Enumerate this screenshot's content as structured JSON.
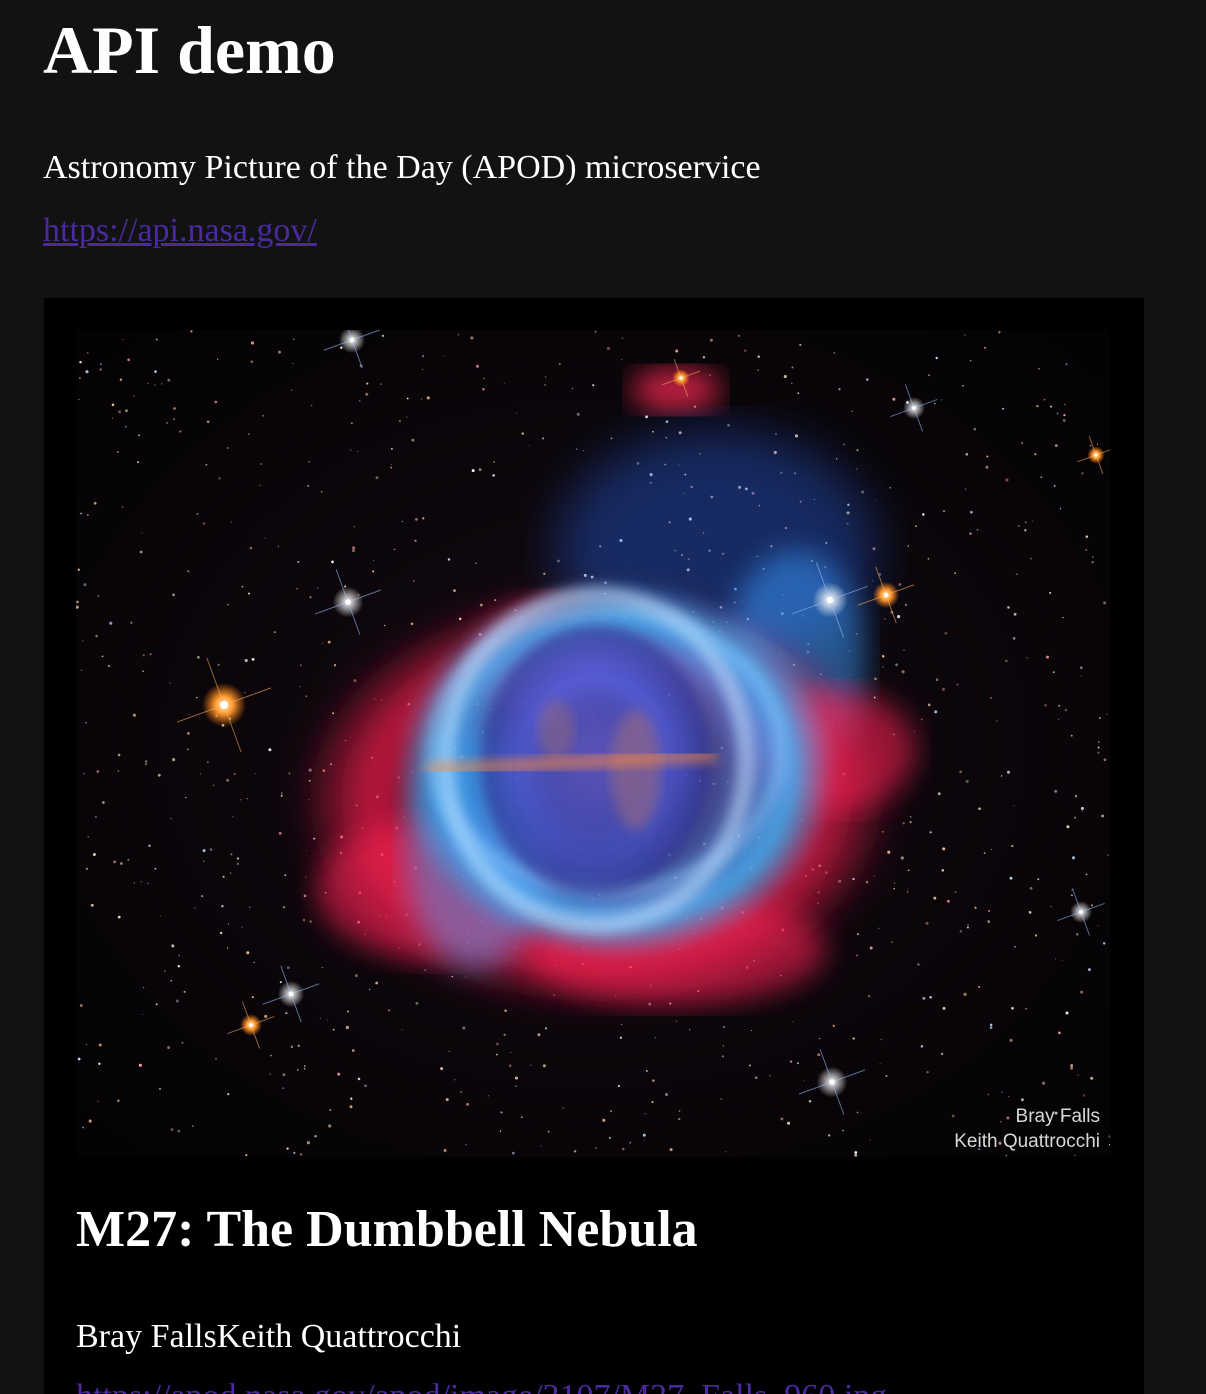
{
  "header": {
    "title": "API demo",
    "subtitle": "Astronomy Picture of the Day (APOD) microservice",
    "api_link": "https://api.nasa.gov/"
  },
  "apod": {
    "image_credit_line1": "Bray Falls",
    "image_credit_line2": "Keith Quattrocchi",
    "title": "M27: The Dumbbell Nebula",
    "copyright": "Bray FallsKeith Quattrocchi",
    "hdurl": "https://apod.nasa.gov/apod/image/2107/M27_Falls_960.jpg"
  },
  "colors": {
    "page_background": "#121212",
    "card_background": "#000000",
    "link": "#4a2a9e",
    "text": "#ffffff"
  }
}
